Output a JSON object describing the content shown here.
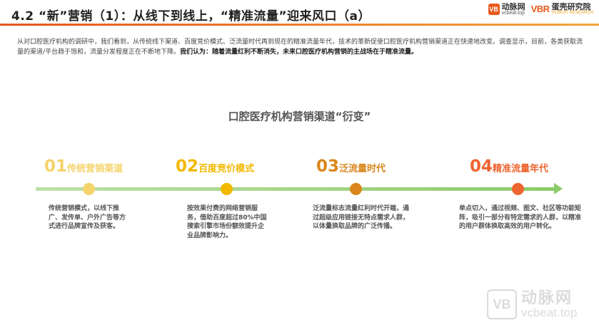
{
  "header": {
    "title": "4.2 “新”营销（1）：从线下到线上，“精准流量”迎来风口（a）",
    "logo1": {
      "mark": "VB",
      "name": "动脉网",
      "url": "vcbeat.top"
    },
    "logo2": {
      "mark": "VBR",
      "name": "蛋壳研究院",
      "sub": "VCBEAT RESEARCH"
    }
  },
  "intro": {
    "text": "从对口腔医疗机构的调研中，我们看到，从传统线下渠道、百度竞价模式、泛流量时代再到现在的精准流量年代，技术的革新促使口腔医疗机构营销渠道正在快速地改变。调查显示，目前，各类获取流量的渠道/平台趋于饱和，流量分发程度正在不断地下降。",
    "bold": "我们认为：随着流量红利不断消失，未来口腔医疗机构营销的主战场在于精准流量。"
  },
  "center_title": "口腔医疗机构营销渠道“衍变”",
  "stages": [
    {
      "num": "01",
      "label": "传统营销渠道",
      "color": "#f5d36a",
      "desc": "传统营销模式，以线下推广、发传单、户外广告等方式进行品牌宣传及获客。"
    },
    {
      "num": "02",
      "label": "百度竞价模式",
      "color": "#f2b900",
      "desc": "按效果付费的网络营销服务，借助百度超过80%中国搜索引擎市场份额效提升企业品牌影响力。"
    },
    {
      "num": "03",
      "label": "泛流量时代",
      "color": "#d9871c",
      "desc": "泛流量标志流量红利时代开端，通过超级应用链接无特点需求人群，以体量换取品牌的广泛传播。"
    },
    {
      "num": "04",
      "label": "精准流量年代",
      "color": "#ee6530",
      "desc": "单点切入，通过视频、图文、社区等功能矩阵，吸引一部分有特定需求的人群，以精准的用户群体换取高效的用户转化。"
    }
  ],
  "watermark": {
    "mark": "VB",
    "name": "动脉网",
    "url": "vcbeat.top"
  }
}
